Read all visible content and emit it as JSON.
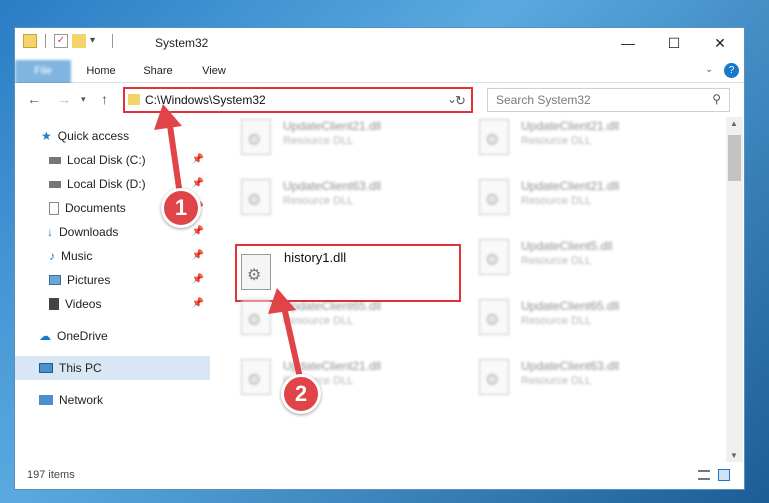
{
  "window": {
    "title": "System32"
  },
  "ribbon": {
    "tabs": [
      "File",
      "Home",
      "Share",
      "View"
    ]
  },
  "address": {
    "path": "C:\\Windows\\System32"
  },
  "search": {
    "placeholder": "Search System32"
  },
  "sidebar": {
    "items": [
      {
        "label": "Quick access"
      },
      {
        "label": "Local Disk (C:)"
      },
      {
        "label": "Local Disk (D:)"
      },
      {
        "label": "Documents"
      },
      {
        "label": "Downloads"
      },
      {
        "label": "Music"
      },
      {
        "label": "Pictures"
      },
      {
        "label": "Videos"
      },
      {
        "label": "OneDrive"
      },
      {
        "label": "This PC"
      },
      {
        "label": "Network"
      }
    ]
  },
  "files": [
    {
      "name": "UpdateClient21.dll",
      "type": "Resource DLL"
    },
    {
      "name": "UpdateClient21.dll",
      "type": "Resource DLL"
    },
    {
      "name": "UpdateClient63.dll",
      "type": "Resource DLL"
    },
    {
      "name": "UpdateClient21.dll",
      "type": "Resource DLL"
    },
    {
      "name": "history1.dll",
      "type": ""
    },
    {
      "name": "UpdateClient5.dll",
      "type": "Resource DLL"
    },
    {
      "name": "UpdateClient65.dll",
      "type": "Resource DLL"
    },
    {
      "name": "UpdateClient65.dll",
      "type": "Resource DLL"
    },
    {
      "name": "UpdateClient21.dll",
      "type": "Resource DLL"
    },
    {
      "name": "UpdateClient63.dll",
      "type": "Resource DLL"
    }
  ],
  "status": {
    "count": "197 items"
  },
  "annotations": {
    "one": "1",
    "two": "2"
  },
  "colors": {
    "accent": "#1979ca",
    "highlight": "#e0323a"
  }
}
